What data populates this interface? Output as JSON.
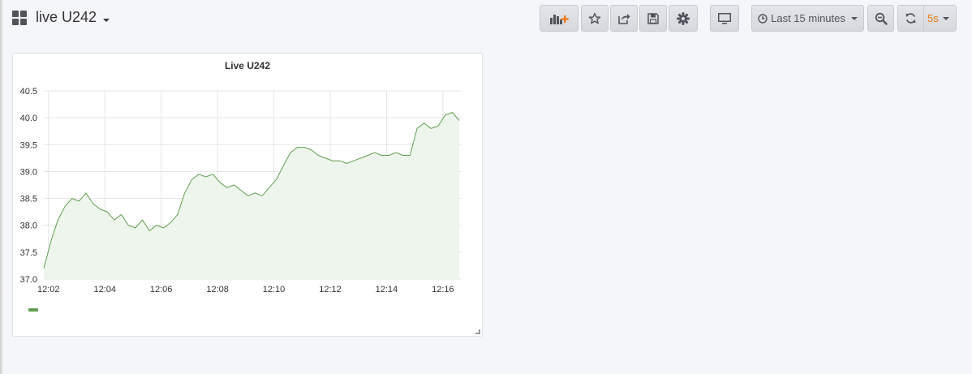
{
  "dashboard": {
    "title": "live U242"
  },
  "toolbar": {
    "add_panel_icon": "bar-chart-plus-icon",
    "star_icon": "star-icon",
    "share_icon": "share-icon",
    "save_icon": "save-icon",
    "settings_icon": "gear-icon",
    "tv_icon": "monitor-icon",
    "time_range": "Last 15 minutes",
    "zoom_icon": "zoom-out-icon",
    "refresh_icon": "refresh-icon",
    "refresh_interval": "5s",
    "accent": "#eb7b18"
  },
  "panel": {
    "title": "Live U242"
  },
  "chart_data": {
    "type": "area",
    "title": "Live U242",
    "color": "#629e51",
    "fill": "#eef5ec",
    "grid": true,
    "ylim": [
      37.0,
      40.5
    ],
    "yticks": [
      "37.0",
      "37.5",
      "38.0",
      "38.5",
      "39.0",
      "39.5",
      "40.0",
      "40.5"
    ],
    "xlim": [
      "12:01:50",
      "12:16:40"
    ],
    "xticks": [
      "12:02",
      "12:04",
      "12:06",
      "12:08",
      "12:10",
      "12:12",
      "12:14",
      "12:16"
    ],
    "series": [
      {
        "x": [
          "12:01:50",
          "12:02:05",
          "12:02:20",
          "12:02:35",
          "12:02:50",
          "12:03:05",
          "12:03:20",
          "12:03:35",
          "12:03:50",
          "12:04:05",
          "12:04:20",
          "12:04:35",
          "12:04:50",
          "12:05:05",
          "12:05:20",
          "12:05:35",
          "12:05:50",
          "12:06:05",
          "12:06:20",
          "12:06:35",
          "12:06:50",
          "12:07:05",
          "12:07:20",
          "12:07:35",
          "12:07:50",
          "12:08:05",
          "12:08:20",
          "12:08:35",
          "12:08:50",
          "12:09:05",
          "12:09:20",
          "12:09:35",
          "12:09:50",
          "12:10:05",
          "12:10:20",
          "12:10:35",
          "12:10:50",
          "12:11:05",
          "12:11:20",
          "12:11:35",
          "12:11:50",
          "12:12:05",
          "12:12:20",
          "12:12:35",
          "12:12:50",
          "12:13:05",
          "12:13:20",
          "12:13:35",
          "12:13:50",
          "12:14:05",
          "12:14:20",
          "12:14:35",
          "12:14:50",
          "12:15:05",
          "12:15:20",
          "12:15:35",
          "12:15:50",
          "12:16:05",
          "12:16:20",
          "12:16:35"
        ],
        "values": [
          37.2,
          37.7,
          38.1,
          38.35,
          38.5,
          38.45,
          38.6,
          38.4,
          38.3,
          38.25,
          38.1,
          38.2,
          38.0,
          37.95,
          38.1,
          37.9,
          38.0,
          37.95,
          38.05,
          38.2,
          38.6,
          38.85,
          38.95,
          38.9,
          38.95,
          38.8,
          38.7,
          38.75,
          38.65,
          38.55,
          38.6,
          38.55,
          38.7,
          38.85,
          39.1,
          39.35,
          39.45,
          39.45,
          39.4,
          39.3,
          39.25,
          39.2,
          39.2,
          39.15,
          39.2,
          39.25,
          39.3,
          39.35,
          39.3,
          39.3,
          39.35,
          39.3,
          39.3,
          39.8,
          39.9,
          39.8,
          39.85,
          40.05,
          40.1,
          39.95
        ]
      }
    ]
  }
}
